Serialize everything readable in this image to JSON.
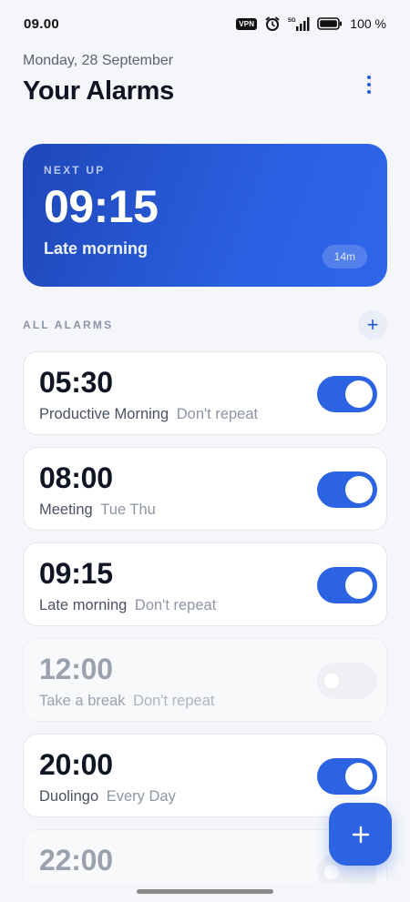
{
  "status_bar": {
    "time": "09.00",
    "vpn": "VPN",
    "network": "5G",
    "battery": "100 %"
  },
  "header": {
    "date": "Monday, 28 September",
    "title": "Your Alarms"
  },
  "next_up": {
    "label": "NEXT UP",
    "time": "09:15",
    "name": "Late morning",
    "countdown": "14m"
  },
  "section": {
    "label": "ALL ALARMS",
    "add_symbol": "+"
  },
  "alarms": [
    {
      "time": "05:30",
      "name": "Productive Morning",
      "repeat": "Don't repeat",
      "enabled": true
    },
    {
      "time": "08:00",
      "name": "Meeting",
      "repeat": "Tue Thu",
      "enabled": true
    },
    {
      "time": "09:15",
      "name": "Late morning",
      "repeat": "Don't repeat",
      "enabled": true
    },
    {
      "time": "12:00",
      "name": "Take a break",
      "repeat": "Don't repeat",
      "enabled": false
    },
    {
      "time": "20:00",
      "name": "Duolingo",
      "repeat": "Every Day",
      "enabled": true
    },
    {
      "time": "22:00",
      "name": "",
      "repeat": "",
      "enabled": false
    }
  ],
  "colors": {
    "accent": "#2b63e3",
    "card_gradient_start": "#1f47b8",
    "card_gradient_end": "#2f66ea",
    "background": "#f4f6fa"
  },
  "icons": {
    "menu": "more-vertical-icon",
    "alarm": "alarm-clock-icon",
    "signal": "signal-icon",
    "battery": "battery-icon",
    "add": "plus-icon"
  }
}
